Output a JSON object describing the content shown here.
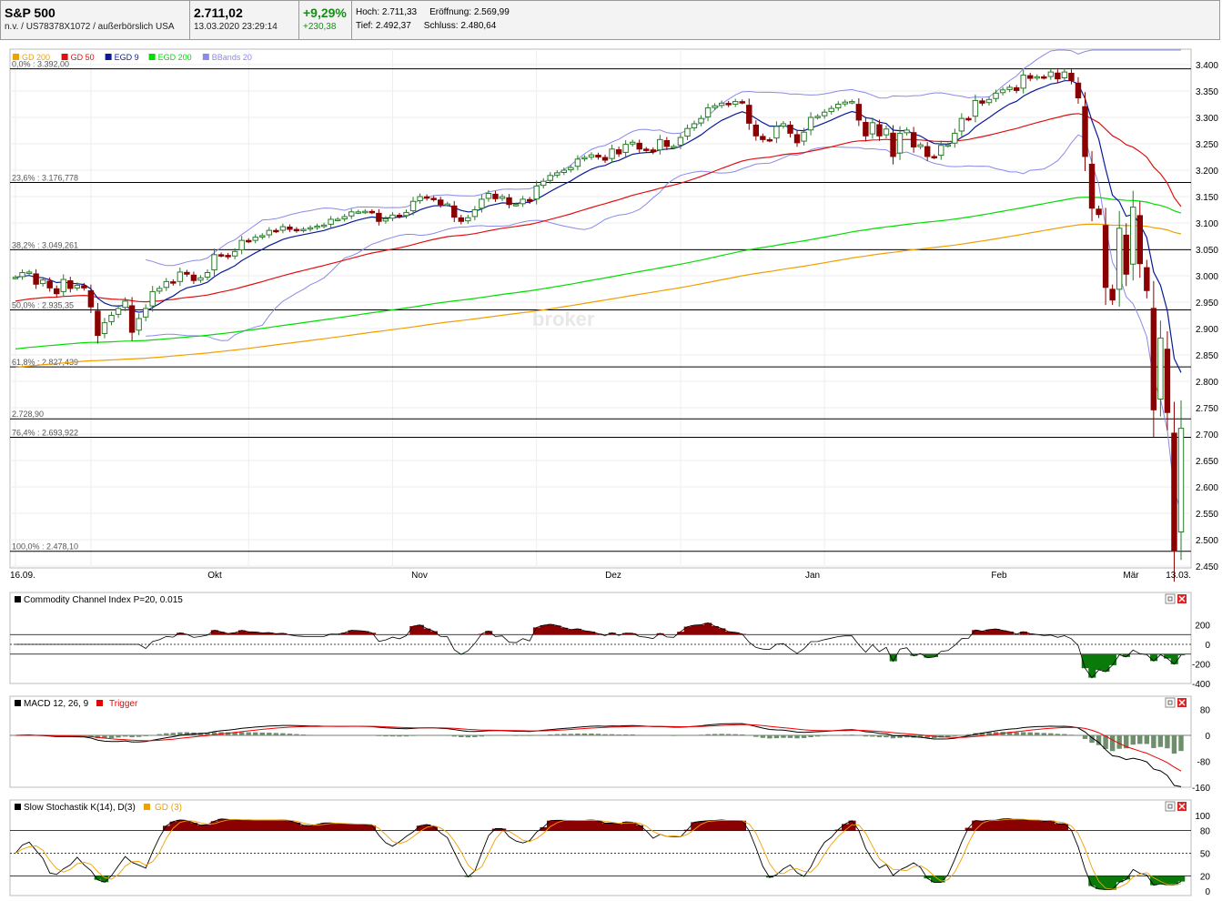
{
  "header": {
    "name": "S&P 500",
    "subline": "n.v. / US78378X1072 / außerbörslich USA",
    "price": "2.711,02",
    "datetime": "13.03.2020 23:29:14",
    "change_pct": "+9,29%",
    "change_abs": "+230,38",
    "high_label": "Hoch:",
    "high": "2.711,33",
    "open_label": "Eröffnung:",
    "open": "2.569,99",
    "low_label": "Tief:",
    "low": "2.492,37",
    "close_label": "Schluss:",
    "close": "2.480,64"
  },
  "watermark": "broker",
  "legend": [
    {
      "label": "GD 200",
      "color": "#f0a000"
    },
    {
      "label": "GD 50",
      "color": "#e01010"
    },
    {
      "label": "EGD 9",
      "color": "#0a1a9a"
    },
    {
      "label": "EGD 200",
      "color": "#00dd00"
    },
    {
      "label": "BBands 20",
      "color": "#8a8ae8"
    }
  ],
  "fib_lines": [
    {
      "label": "0,0% : 3.392,00",
      "value": 3392.0
    },
    {
      "label": "23,6% : 3.176,778",
      "value": 3176.778
    },
    {
      "label": "38,2% : 3.049,261",
      "value": 3049.261
    },
    {
      "label": "50,0% : 2.935,35",
      "value": 2935.35
    },
    {
      "label": "61,8% : 2.827,439",
      "value": 2827.439
    },
    {
      "label": "2.728,90",
      "value": 2728.9
    },
    {
      "label": "76,4% : 2.693,922",
      "value": 2693.922
    },
    {
      "label": "100,0% : 2.478,10",
      "value": 2478.1
    }
  ],
  "x_labels": [
    "16.09.",
    "Okt",
    "Nov",
    "Dez",
    "Jan",
    "Feb",
    "Mär",
    "13.03."
  ],
  "cci_panel": {
    "title": "Commodity Channel Index P=20, 0.015",
    "ticks": [
      "200",
      "0",
      "-200",
      "-400"
    ]
  },
  "macd_panel": {
    "title": "MACD 12, 26, 9",
    "trigger": "Trigger",
    "ticks": [
      "80",
      "0",
      "-80",
      "-160"
    ]
  },
  "stoch_panel": {
    "title": "Slow Stochastik K(14), D(3)",
    "gd": "GD (3)",
    "ticks": [
      "100",
      "80",
      "50",
      "20",
      "0"
    ]
  },
  "chart_data": {
    "type": "candlestick",
    "title": "S&P 500",
    "y_ticks": [
      "3.400",
      "3.350",
      "3.300",
      "3.250",
      "3.200",
      "3.150",
      "3.100",
      "3.050",
      "3.000",
      "2.950",
      "2.900",
      "2.850",
      "2.800",
      "2.750",
      "2.700",
      "2.650",
      "2.600",
      "2.550",
      "2.500",
      "2.450"
    ],
    "ylim": [
      2450,
      3400
    ],
    "x_axis_dates": [
      "16.09.",
      "Okt",
      "Nov",
      "Dez",
      "Jan",
      "Feb",
      "Mär",
      "13.03."
    ],
    "closes": [
      2997,
      3006,
      3007,
      2984,
      2992,
      2977,
      2966,
      2993,
      2976,
      2982,
      2977,
      2941,
      2887,
      2911,
      2925,
      2938,
      2952,
      2893,
      2919,
      2938,
      2970,
      2976,
      2989,
      2986,
      3007,
      3003,
      2991,
      2996,
      3006,
      3040,
      3039,
      3036,
      3046,
      3067,
      3066,
      3073,
      3076,
      3086,
      3085,
      3093,
      3088,
      3086,
      3088,
      3091,
      3094,
      3096,
      3107,
      3107,
      3112,
      3121,
      3121,
      3122,
      3121,
      3103,
      3108,
      3115,
      3113,
      3120,
      3141,
      3150,
      3147,
      3145,
      3135,
      3136,
      3111,
      3103,
      3110,
      3125,
      3145,
      3156,
      3146,
      3150,
      3135,
      3135,
      3145,
      3141,
      3170,
      3179,
      3190,
      3195,
      3200,
      3205,
      3221,
      3224,
      3229,
      3225,
      3219,
      3240,
      3231,
      3249,
      3253,
      3240,
      3239,
      3235,
      3258,
      3245,
      3245,
      3262,
      3279,
      3288,
      3298,
      3318,
      3322,
      3327,
      3324,
      3330,
      3329,
      3289,
      3265,
      3258,
      3257,
      3283,
      3288,
      3270,
      3252,
      3272,
      3300,
      3302,
      3310,
      3317,
      3325,
      3329,
      3330,
      3295,
      3265,
      3290,
      3265,
      3278,
      3226,
      3270,
      3276,
      3244,
      3248,
      3226,
      3225,
      3247,
      3248,
      3270,
      3298,
      3297,
      3332,
      3327,
      3334,
      3346,
      3352,
      3357,
      3351,
      3380,
      3374,
      3377,
      3376,
      3386,
      3373,
      3386,
      3370,
      3337,
      3226,
      3128,
      3116,
      2978,
      2954,
      3090,
      3003,
      3130,
      3023,
      2972,
      2746,
      2882,
      2741,
      2480,
      2711
    ]
  }
}
